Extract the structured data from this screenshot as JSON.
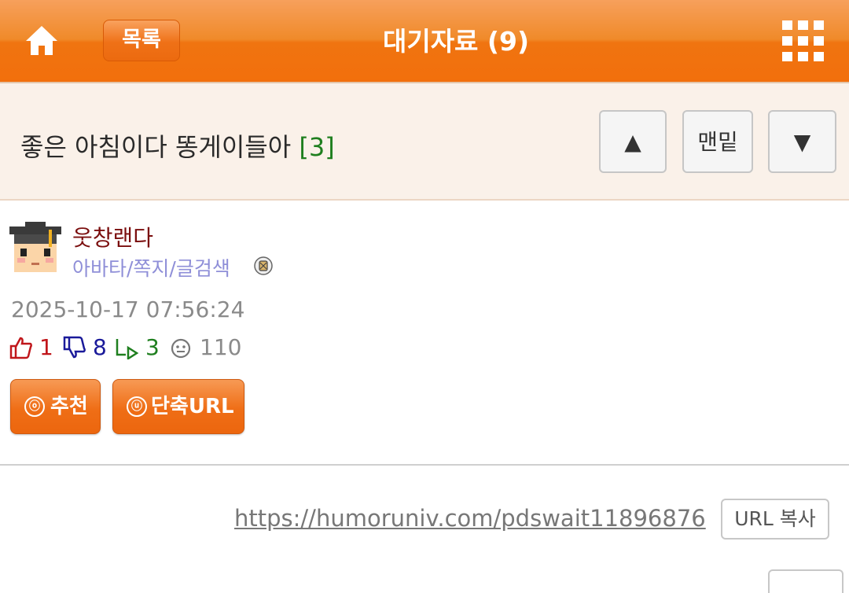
{
  "header": {
    "list_label": "목록",
    "title": "대기자료 (9)",
    "home_icon": "home-icon",
    "menu_icon": "grid-menu-icon"
  },
  "post": {
    "subject": "좋은 아침이다 똥게이들아",
    "comment_count": "[3]",
    "nav": {
      "up": "▲",
      "bottom": "맨밑",
      "down": "▼"
    },
    "author": {
      "name": "웃창랜다",
      "links": "아바타/쪽지/글검색",
      "badge_icon": "member-badge-icon"
    },
    "datetime": "2025-10-17 07:56:24",
    "stats": {
      "likes": "1",
      "dislikes": "8",
      "replies": "3",
      "views": "110"
    },
    "actions": {
      "recommend": "추천",
      "short_url": "단축URL",
      "recommend_mark": "ⓞ",
      "short_url_mark": "ⓤ"
    },
    "url": "https://humoruniv.com/pdswait11896876",
    "copy_label": "URL 복사"
  },
  "colors": {
    "header_orange": "#f07410",
    "author_name": "#7a0d0d",
    "likes": "#c0161b",
    "dislikes": "#1a1a9a",
    "replies": "#1f7f1f",
    "link": "#8f8fd8"
  }
}
